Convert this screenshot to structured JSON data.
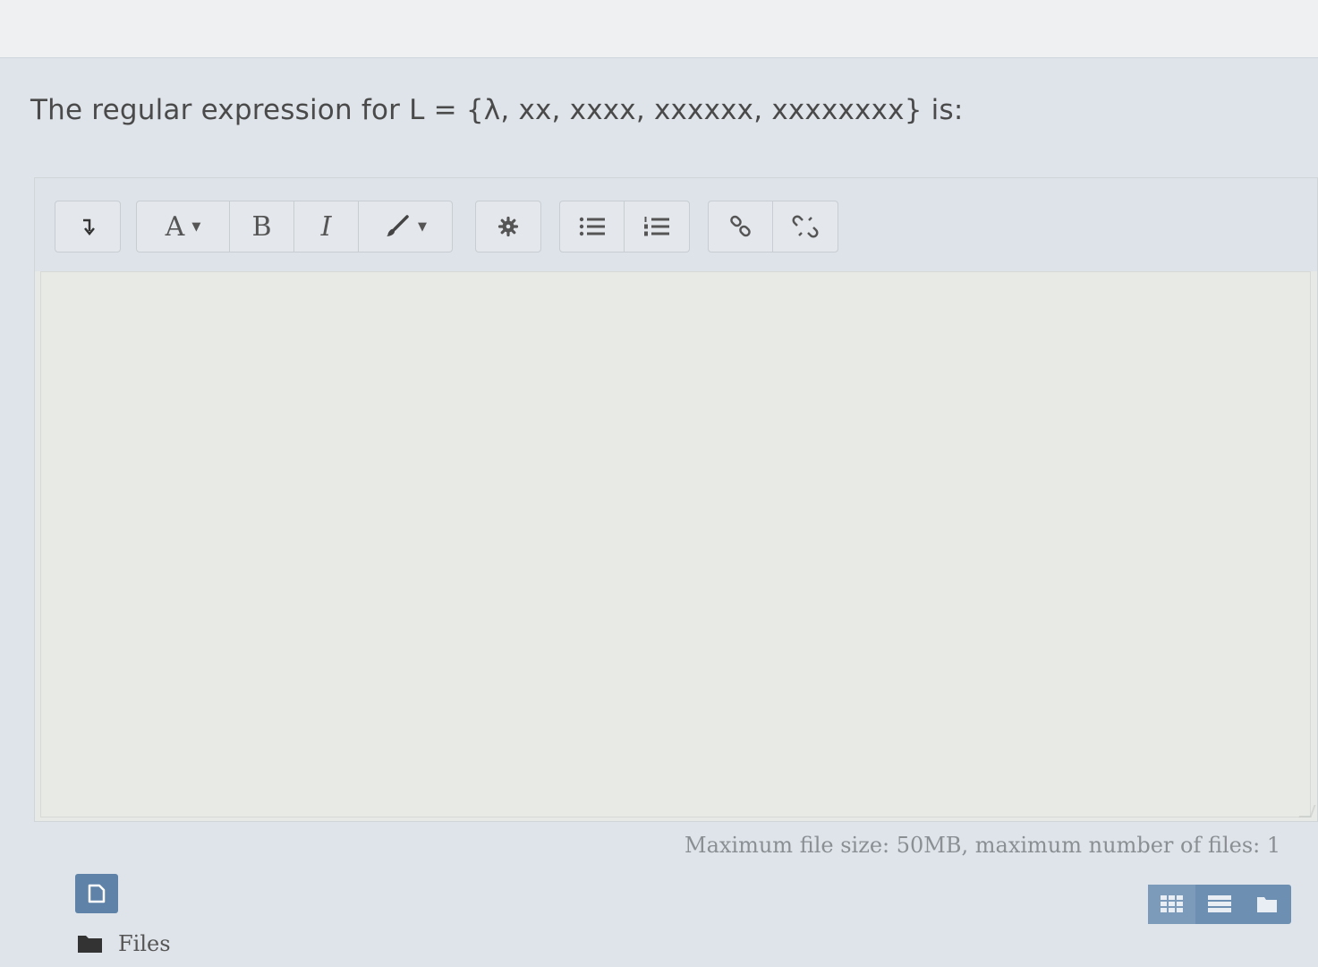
{
  "question": {
    "text": "The regular expression for L = {λ, xx, xxxx, xxxxxx, xxxxxxxx} is:"
  },
  "toolbar": {
    "toggle_icon": "collapse-toggle-icon",
    "paragraph_label": "A",
    "bold_label": "B",
    "italic_label": "I",
    "style_icon": "paintbrush-icon",
    "settings_icon": "gear-icon",
    "unordered_list_icon": "unordered-list-icon",
    "ordered_list_icon": "ordered-list-icon",
    "link_icon": "link-icon",
    "unlink_icon": "unlink-icon"
  },
  "editor": {
    "content": ""
  },
  "filepicker": {
    "restrictions": "Maximum file size: 50MB, maximum number of files: 1",
    "files_label": "Files",
    "views": [
      "grid-view",
      "list-view",
      "tree-view"
    ],
    "active_view": "grid-view"
  },
  "colors": {
    "panel_bg": "#dfe4ea",
    "accent": "#5f83a8"
  }
}
